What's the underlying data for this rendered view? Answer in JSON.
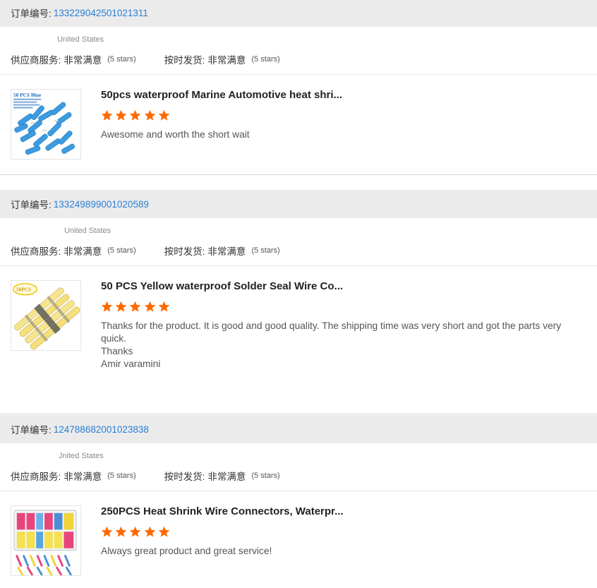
{
  "orders": [
    {
      "label": "订单编号:",
      "order_id": "133229042501021311",
      "country": "United States",
      "supplier_label": "供应商服务:",
      "supplier_value": "非常满意",
      "supplier_stars": "(5 stars)",
      "shipping_label": "按时发货:",
      "shipping_value": "非常满意",
      "shipping_stars": "(5 stars)",
      "product_title": "50pcs waterproof Marine Automotive heat shri...",
      "rating": 5,
      "review": "Awesome and worth the short wait",
      "thumb_text": "50 PCS Blue"
    },
    {
      "label": "订单编号:",
      "order_id": "133249899001020589",
      "country": "United States",
      "supplier_label": "供应商服务:",
      "supplier_value": "非常满意",
      "supplier_stars": "(5 stars)",
      "shipping_label": "按时发货:",
      "shipping_value": "非常满意",
      "shipping_stars": "(5 stars)",
      "product_title": "50 PCS Yellow waterproof Solder Seal Wire Co...",
      "rating": 5,
      "review": "Thanks for the product. It is good and good quality. The shipping time was very short and got the parts very quick.\nThanks\nAmir varamini",
      "thumb_text": "50PCS"
    },
    {
      "label": "订单编号:",
      "order_id": "124788682001023838",
      "country": "Jnited States",
      "supplier_label": "供应商服务:",
      "supplier_value": "非常满意",
      "supplier_stars": "(5 stars)",
      "shipping_label": "按时发货:",
      "shipping_value": "非常满意",
      "shipping_stars": "(5 stars)",
      "product_title": "250PCS Heat Shrink Wire Connectors, Waterpr...",
      "rating": 5,
      "review": "Always great product and great service!",
      "thumb_text": ""
    }
  ],
  "colors": {
    "header_bg": "#ebebeb",
    "link": "#2a7fd4",
    "star": "#ff6a00"
  },
  "icons": {
    "star": "star-icon"
  }
}
